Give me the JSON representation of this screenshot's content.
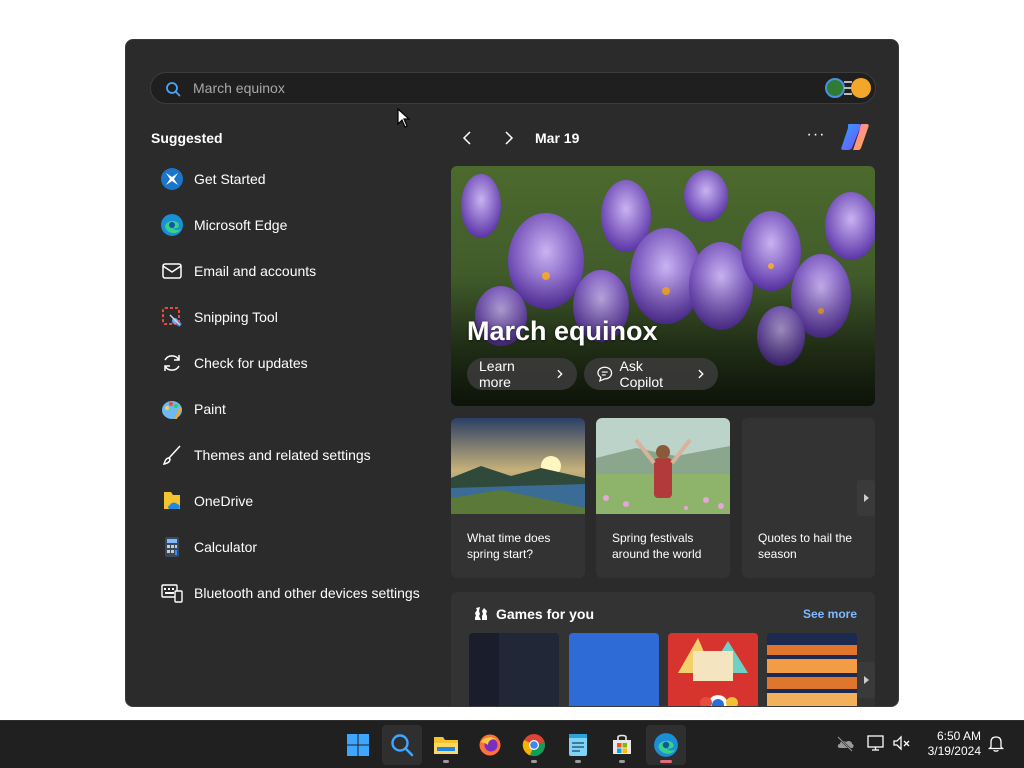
{
  "search": {
    "placeholder": "March equinox"
  },
  "suggested": {
    "title": "Suggested",
    "items": [
      {
        "label": "Get Started",
        "icon": "get-started-icon"
      },
      {
        "label": "Microsoft Edge",
        "icon": "edge-icon"
      },
      {
        "label": "Email and accounts",
        "icon": "mail-icon"
      },
      {
        "label": "Snipping Tool",
        "icon": "snipping-tool-icon"
      },
      {
        "label": "Check for updates",
        "icon": "refresh-icon"
      },
      {
        "label": "Paint",
        "icon": "paint-icon"
      },
      {
        "label": "Themes and related settings",
        "icon": "brush-icon"
      },
      {
        "label": "OneDrive",
        "icon": "onedrive-icon"
      },
      {
        "label": "Calculator",
        "icon": "calculator-icon"
      },
      {
        "label": "Bluetooth and other devices settings",
        "icon": "devices-icon"
      }
    ]
  },
  "highlights": {
    "date": "Mar 19",
    "more": "···",
    "hero": {
      "title": "March equinox",
      "learn_more": "Learn more",
      "ask_copilot": "Ask Copilot"
    },
    "cards": [
      {
        "text": "What time does spring start?"
      },
      {
        "text": "Spring festivals around the world"
      },
      {
        "text": "Quotes to hail the season"
      }
    ],
    "games": {
      "title": "Games for you",
      "see_more": "See more"
    }
  },
  "taskbar": {
    "apps": [
      "start-icon",
      "search-icon",
      "file-explorer-icon",
      "firefox-icon",
      "chrome-icon",
      "notepad-icon",
      "store-icon",
      "edge-icon"
    ],
    "time": "6:50 AM",
    "date": "3/19/2024"
  },
  "colors": {
    "panel_bg": "#2b2b2b",
    "accent_link": "#7fb9ff",
    "taskbar_bg": "#202020"
  }
}
